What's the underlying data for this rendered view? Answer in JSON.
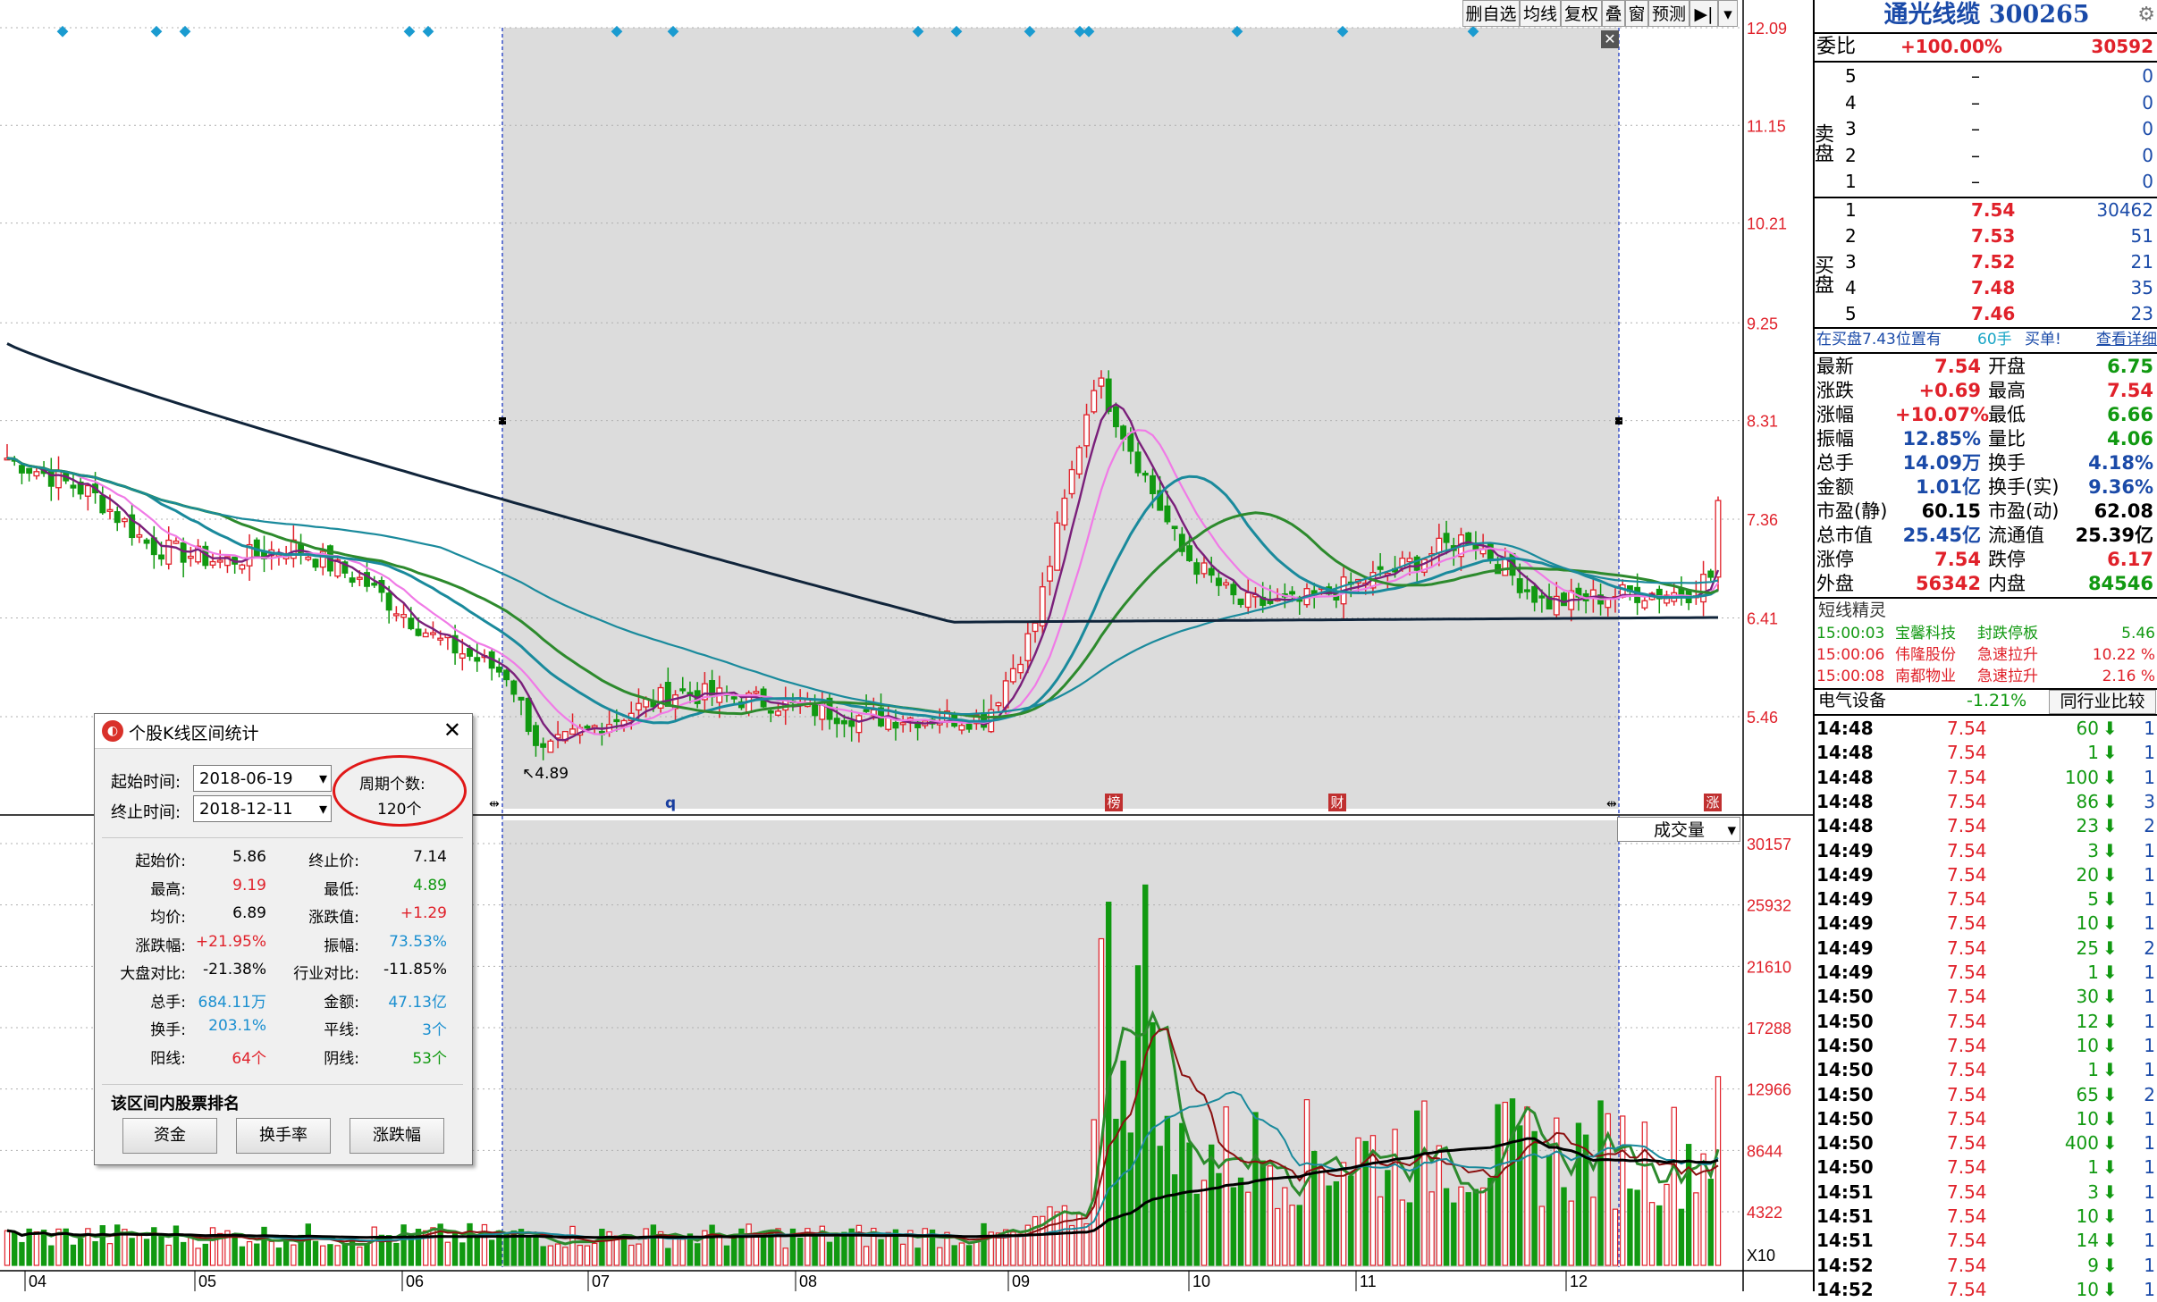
{
  "toolbar": {
    "del_watch": "删自选",
    "ma": "均线",
    "restore": "复权",
    "overlay": "叠",
    "window": "窗",
    "forecast": "预测",
    "arrow": "▶|",
    "dropdown": "▾"
  },
  "price_axis": [
    "12.09",
    "11.15",
    "10.21",
    "9.25",
    "8.31",
    "7.36",
    "6.41",
    "5.46"
  ],
  "volume_axis": [
    "30157",
    "25932",
    "21610",
    "17288",
    "12966",
    "8644",
    "4322",
    "X10"
  ],
  "x_axis": [
    "04",
    "05",
    "06",
    "07",
    "08",
    "09",
    "10",
    "11",
    "12"
  ],
  "markers": {
    "low_label": "4.89",
    "q_label": "q",
    "bang": "榜",
    "cai": "财",
    "zhang": "涨"
  },
  "volume_selector": "成交量",
  "quote": {
    "title": "通光线缆 300265",
    "weibi_label": "委比",
    "weibi_pct": "+100.00%",
    "weibi_val": "30592",
    "sell_label": "卖盘",
    "buy_label": "买盘",
    "sell": [
      {
        "n": "5",
        "p": "–",
        "v": "0"
      },
      {
        "n": "4",
        "p": "–",
        "v": "0"
      },
      {
        "n": "3",
        "p": "–",
        "v": "0"
      },
      {
        "n": "2",
        "p": "–",
        "v": "0"
      },
      {
        "n": "1",
        "p": "–",
        "v": "0"
      }
    ],
    "buy": [
      {
        "n": "1",
        "p": "7.54",
        "v": "30462"
      },
      {
        "n": "2",
        "p": "7.53",
        "v": "51"
      },
      {
        "n": "3",
        "p": "7.52",
        "v": "21"
      },
      {
        "n": "4",
        "p": "7.48",
        "v": "35"
      },
      {
        "n": "5",
        "p": "7.46",
        "v": "23"
      }
    ],
    "note_pos": "在买盘7.43位置有",
    "note_qty": "60手",
    "note_buy": "买单!",
    "note_link": "查看详细",
    "stats": [
      {
        "l1": "最新",
        "v1": "7.54",
        "l2": "开盘",
        "v2": "6.75"
      },
      {
        "l1": "涨跌",
        "v1": "+0.69",
        "l2": "最高",
        "v2": "7.54"
      },
      {
        "l1": "涨幅",
        "v1": "+10.07%",
        "l2": "最低",
        "v2": "6.66"
      },
      {
        "l1": "振幅",
        "v1": "12.85%",
        "l2": "量比",
        "v2": "4.06"
      },
      {
        "l1": "总手",
        "v1": "14.09万",
        "l2": "换手",
        "v2": "4.18%"
      },
      {
        "l1": "金额",
        "v1": "1.01亿",
        "l2": "换手(实)",
        "v2": "9.36%"
      },
      {
        "l1": "市盈(静)",
        "v1": "60.15",
        "l2": "市盈(动)",
        "v2": "62.08"
      },
      {
        "l1": "总市值",
        "v1": "25.45亿",
        "l2": "流通值",
        "v2": "25.39亿"
      },
      {
        "l1": "涨停",
        "v1": "7.54",
        "l2": "跌停",
        "v2": "6.17"
      },
      {
        "l1": "外盘",
        "v1": "56342",
        "l2": "内盘",
        "v2": "84546"
      }
    ],
    "spirit_title": "短线精灵",
    "spirit": [
      {
        "t": "15:00:03",
        "name": "宝馨科技",
        "evt": "封跌停板",
        "val": "5.46"
      },
      {
        "t": "15:00:06",
        "name": "伟隆股份",
        "evt": "急速拉升",
        "val": "10.22 %"
      },
      {
        "t": "15:00:08",
        "name": "南都物业",
        "evt": "急速拉升",
        "val": "2.16 %"
      }
    ],
    "sector": "电气设备",
    "sector_pct": "-1.21%",
    "compare": "同行业比较",
    "ticks": [
      {
        "t": "14:48",
        "p": "7.54",
        "v": "60",
        "c": "1"
      },
      {
        "t": "14:48",
        "p": "7.54",
        "v": "1",
        "c": "1"
      },
      {
        "t": "14:48",
        "p": "7.54",
        "v": "100",
        "c": "1"
      },
      {
        "t": "14:48",
        "p": "7.54",
        "v": "86",
        "c": "3"
      },
      {
        "t": "14:48",
        "p": "7.54",
        "v": "23",
        "c": "2"
      },
      {
        "t": "14:49",
        "p": "7.54",
        "v": "3",
        "c": "1"
      },
      {
        "t": "14:49",
        "p": "7.54",
        "v": "20",
        "c": "1"
      },
      {
        "t": "14:49",
        "p": "7.54",
        "v": "5",
        "c": "1"
      },
      {
        "t": "14:49",
        "p": "7.54",
        "v": "10",
        "c": "1"
      },
      {
        "t": "14:49",
        "p": "7.54",
        "v": "25",
        "c": "2"
      },
      {
        "t": "14:49",
        "p": "7.54",
        "v": "1",
        "c": "1"
      },
      {
        "t": "14:50",
        "p": "7.54",
        "v": "30",
        "c": "1"
      },
      {
        "t": "14:50",
        "p": "7.54",
        "v": "12",
        "c": "1"
      },
      {
        "t": "14:50",
        "p": "7.54",
        "v": "10",
        "c": "1"
      },
      {
        "t": "14:50",
        "p": "7.54",
        "v": "1",
        "c": "1"
      },
      {
        "t": "14:50",
        "p": "7.54",
        "v": "65",
        "c": "2"
      },
      {
        "t": "14:50",
        "p": "7.54",
        "v": "10",
        "c": "1"
      },
      {
        "t": "14:50",
        "p": "7.54",
        "v": "400",
        "c": "1"
      },
      {
        "t": "14:50",
        "p": "7.54",
        "v": "1",
        "c": "1"
      },
      {
        "t": "14:51",
        "p": "7.54",
        "v": "3",
        "c": "1"
      },
      {
        "t": "14:51",
        "p": "7.54",
        "v": "10",
        "c": "1"
      },
      {
        "t": "14:51",
        "p": "7.54",
        "v": "14",
        "c": "1"
      },
      {
        "t": "14:52",
        "p": "7.54",
        "v": "9",
        "c": "1"
      },
      {
        "t": "14:52",
        "p": "7.54",
        "v": "10",
        "c": "1"
      }
    ]
  },
  "dialog": {
    "title": "个股K线区间统计",
    "start_label": "起始时间:",
    "start_val": "2018-06-19",
    "end_label": "终止时间:",
    "end_val": "2018-12-11",
    "period_label": "周期个数:",
    "period_val": "120个",
    "stats": [
      {
        "l1": "起始价:",
        "v1": "5.86",
        "l2": "终止价:",
        "v2": "7.14"
      },
      {
        "l1": "最高:",
        "v1": "9.19",
        "l2": "最低:",
        "v2": "4.89"
      },
      {
        "l1": "均价:",
        "v1": "6.89",
        "l2": "涨跌值:",
        "v2": "+1.29"
      },
      {
        "l1": "涨跌幅:",
        "v1": "+21.95%",
        "l2": "振幅:",
        "v2": "73.53%"
      },
      {
        "l1": "大盘对比:",
        "v1": "-21.38%",
        "l2": "行业对比:",
        "v2": "-11.85%"
      },
      {
        "l1": "总手:",
        "v1": "684.11万",
        "l2": "金额:",
        "v2": "47.13亿"
      },
      {
        "l1": "换手:",
        "v1": "203.1%",
        "l2": "平线:",
        "v2": "3个"
      },
      {
        "l1": "阳线:",
        "v1": "64个",
        "l2": "阴线:",
        "v2": "53个"
      }
    ],
    "rank_title": "该区间内股票排名",
    "btn_fund": "资金",
    "btn_turnover": "换手率",
    "btn_change": "涨跌幅"
  },
  "colors": {
    "up": "#e0212a",
    "down": "#119911",
    "blue": "#1a6fd0",
    "cyan": "#18a5c6",
    "selection": "#dcdcdc"
  }
}
